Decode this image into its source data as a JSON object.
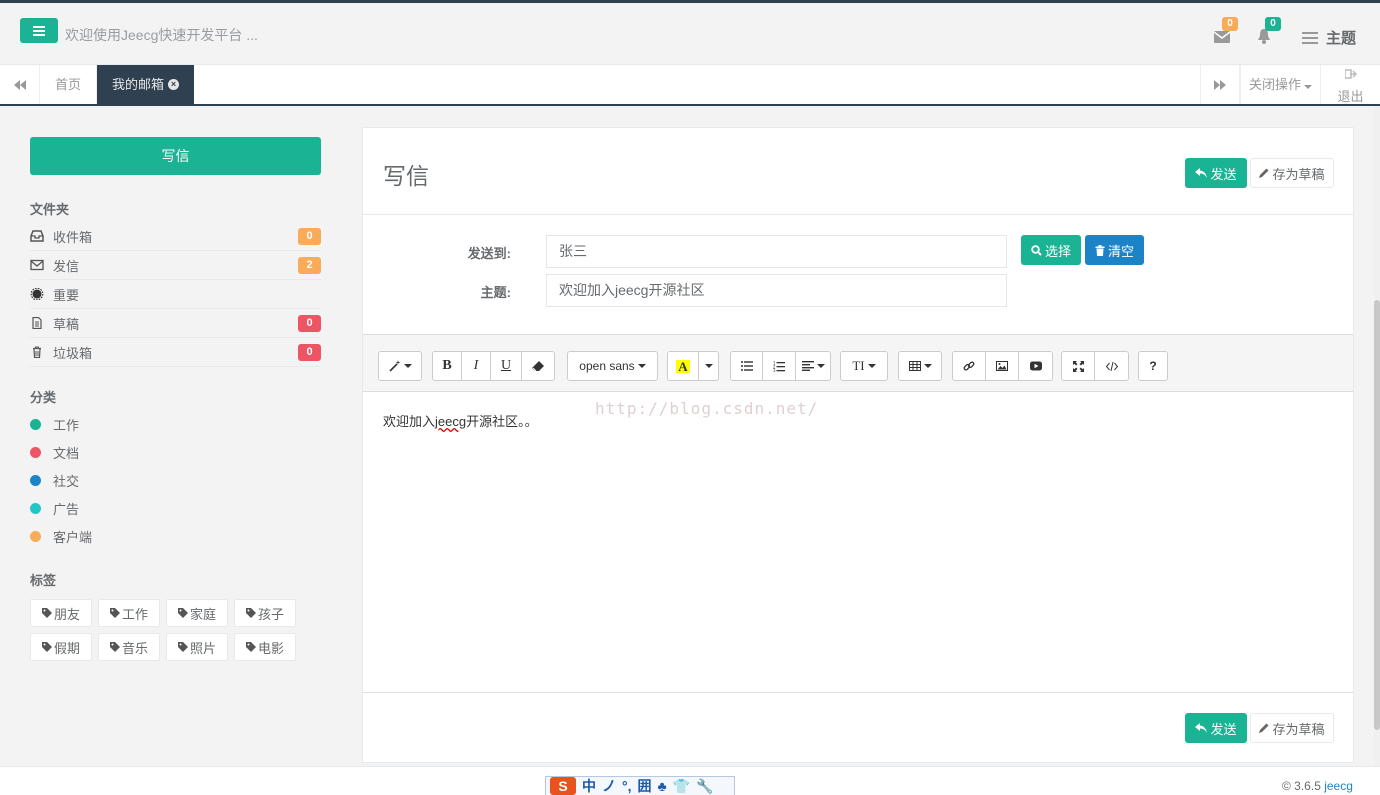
{
  "header": {
    "welcome": "欢迎使用Jeecg快速开发平台 ...",
    "mail_count": "0",
    "notice_count": "0",
    "theme_label": "主题"
  },
  "tabs": {
    "home": "首页",
    "active": "我的邮箱",
    "close_ops": "关闭操作",
    "logout": "退出"
  },
  "sidebar": {
    "compose": "写信",
    "folders_heading": "文件夹",
    "folders": [
      {
        "label": "收件箱",
        "count": "0",
        "icon": "inbox-icon",
        "badge_color": "#f8ac59"
      },
      {
        "label": "发信",
        "count": "2",
        "icon": "envelope-icon",
        "badge_color": "#f8ac59"
      },
      {
        "label": "重要",
        "icon": "certificate-icon"
      },
      {
        "label": "草稿",
        "count": "0",
        "icon": "file-icon",
        "badge_color": "#ed5565"
      },
      {
        "label": "垃圾箱",
        "count": "0",
        "icon": "trash-icon",
        "badge_color": "#ed5565"
      }
    ],
    "categories_heading": "分类",
    "categories": [
      {
        "label": "工作",
        "color": "#1ab394"
      },
      {
        "label": "文档",
        "color": "#ed5565"
      },
      {
        "label": "社交",
        "color": "#1c84c6"
      },
      {
        "label": "广告",
        "color": "#23c6c8"
      },
      {
        "label": "客户端",
        "color": "#f8ac59"
      }
    ],
    "tags_heading": "标签",
    "tags": [
      "朋友",
      "工作",
      "家庭",
      "孩子",
      "假期",
      "音乐",
      "照片",
      "电影"
    ]
  },
  "compose": {
    "title": "写信",
    "send": "发送",
    "save_draft": "存为草稿",
    "to_label": "发送到:",
    "to_value": "张三",
    "select": "选择",
    "clear": "清空",
    "subject_label": "主题:",
    "subject_value": "欢迎加入jeecg开源社区",
    "font_name": "open sans",
    "body_prefix": "欢迎加入",
    "body_misspelled": "jeecg",
    "body_suffix": "开源社区。。",
    "watermark": "http://blog.csdn.net/"
  },
  "footer": {
    "version": "© 3.6.5 ",
    "brand": "jeecg",
    "ime_chars": [
      "中",
      "ノ",
      "°,",
      "囲",
      "♣",
      "👕",
      "🔧"
    ]
  },
  "colors": {
    "primary": "#1ab394",
    "info": "#1c84c6",
    "warning": "#f8ac59",
    "danger": "#ed5565",
    "nav_dark": "#2f4050"
  }
}
